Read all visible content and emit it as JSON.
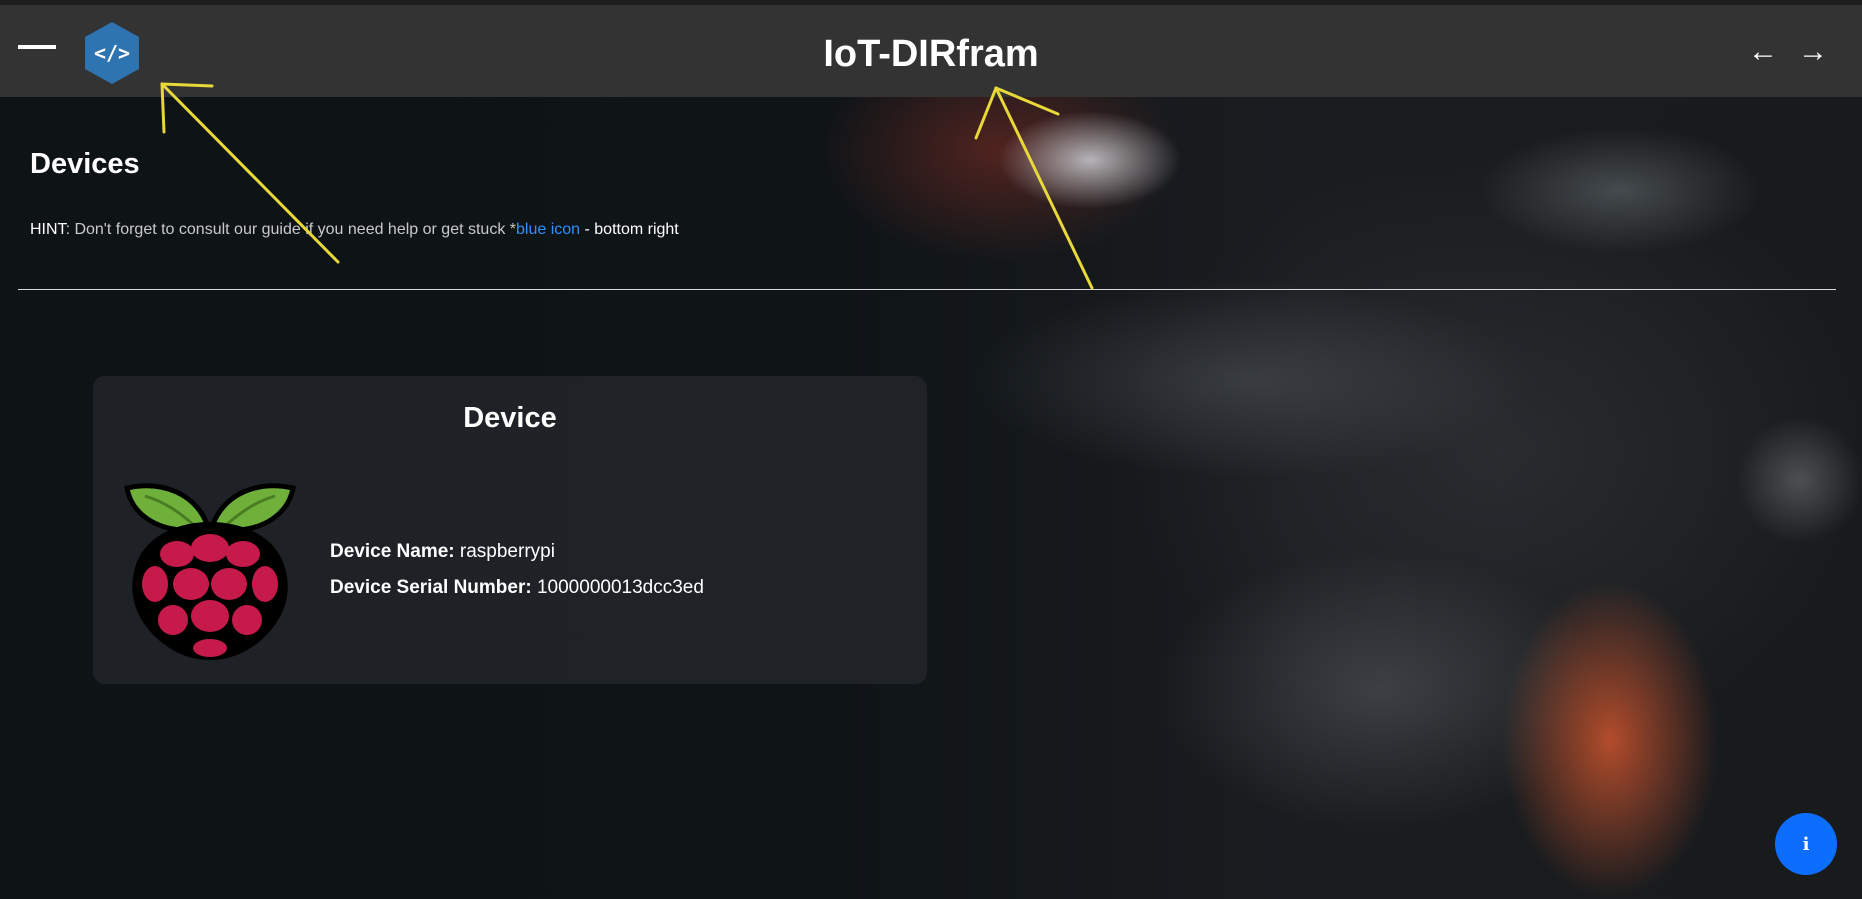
{
  "header": {
    "title": "IoT-DIRfram",
    "back_arrow": "←",
    "forward_arrow": "→",
    "menu_icon": "hamburger-menu-icon",
    "logo_icon": "code-hexagon-icon",
    "logo_glyph": "</>"
  },
  "page": {
    "title": "Devices",
    "hint": {
      "label": "HINT",
      "text": ": Don't forget to consult our guide if you need help or get stuck *",
      "link": "blue icon",
      "tail": " - bottom right"
    }
  },
  "device_card": {
    "title": "Device",
    "image_icon": "raspberry-pi-logo",
    "name_label": "Device Name:",
    "name_value": "raspberrypi",
    "serial_label": "Device Serial Number:",
    "serial_value": "1000000013dcc3ed"
  },
  "info_button": {
    "glyph": "i",
    "icon": "info-icon"
  },
  "colors": {
    "navbar": "#333333",
    "accent": "#0d6efd",
    "link": "#2f8fff",
    "annotation": "#e8d83a",
    "logo": "#2d74b0"
  }
}
